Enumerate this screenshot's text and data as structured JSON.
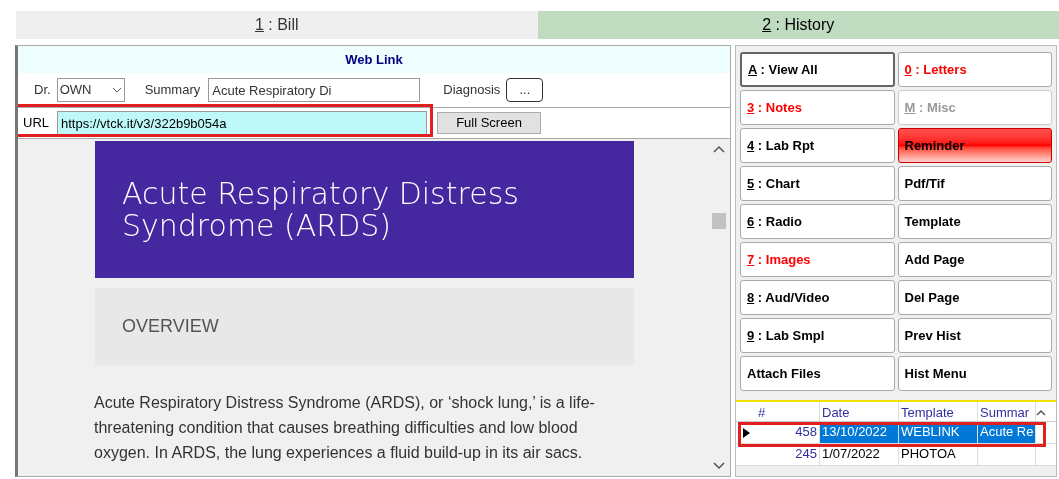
{
  "tabs": [
    {
      "key": "1",
      "label": " : Bill",
      "selected": false
    },
    {
      "key": "2",
      "label": " : History",
      "selected": true
    }
  ],
  "panel_title": "Web Link",
  "form": {
    "doctor_label": "Dr.",
    "doctor_value": "OWN",
    "summary_label": "Summary",
    "summary_value": "Acute Respiratory Di",
    "diagnosis_label": "Diagnosis",
    "diagnosis_button": "...",
    "url_label": "URL",
    "url_value": "https://vtck.it/v3/322b9b054a",
    "full_screen_button": "Full Screen"
  },
  "web_page": {
    "title": "Acute Respiratory Distress Syndrome (ARDS)",
    "section": "OVERVIEW",
    "paragraph": "Acute Respiratory Distress Syndrome (ARDS), or ‘shock lung,’ is a life-threatening condition that causes breathing difficulties and low blood oxygen. In ARDS, the lung experiences a fluid build-up in its air sacs."
  },
  "buttons": [
    {
      "key": "A",
      "label": " : View All",
      "kind": "default"
    },
    {
      "key": "0",
      "label": " : Letters",
      "kind": "red"
    },
    {
      "key": "3",
      "label": " : Notes",
      "kind": "red"
    },
    {
      "key": "M",
      "label": " : Misc",
      "kind": "disabled"
    },
    {
      "key": "4",
      "label": " : Lab Rpt",
      "kind": "normal"
    },
    {
      "label": "Reminder",
      "kind": "alert"
    },
    {
      "key": "5",
      "label": " : Chart",
      "kind": "normal"
    },
    {
      "label": "Pdf/Tif",
      "kind": "normal"
    },
    {
      "key": "6",
      "label": " : Radio",
      "kind": "normal"
    },
    {
      "label": "Template",
      "kind": "normal"
    },
    {
      "key": "7",
      "label": " : Images",
      "kind": "red"
    },
    {
      "label": "Add Page",
      "kind": "normal"
    },
    {
      "key": "8",
      "label": " : Aud/Video",
      "kind": "normal"
    },
    {
      "label": "Del Page",
      "kind": "normal"
    },
    {
      "key": "9",
      "label": " : Lab Smpl",
      "kind": "normal"
    },
    {
      "label": "Prev Hist",
      "kind": "normal"
    },
    {
      "label": "Attach Files",
      "kind": "normal"
    },
    {
      "label": "Hist Menu",
      "kind": "normal"
    }
  ],
  "table": {
    "columns": [
      "#",
      "Date",
      "Template",
      "Summar"
    ],
    "rows": [
      {
        "cells": [
          "458",
          "13/10/2022",
          "WEBLINK",
          "Acute Re"
        ],
        "selected": true
      },
      {
        "cells": [
          "245",
          "1/07/2022",
          "PHOTOA",
          ""
        ],
        "selected": false
      }
    ]
  }
}
